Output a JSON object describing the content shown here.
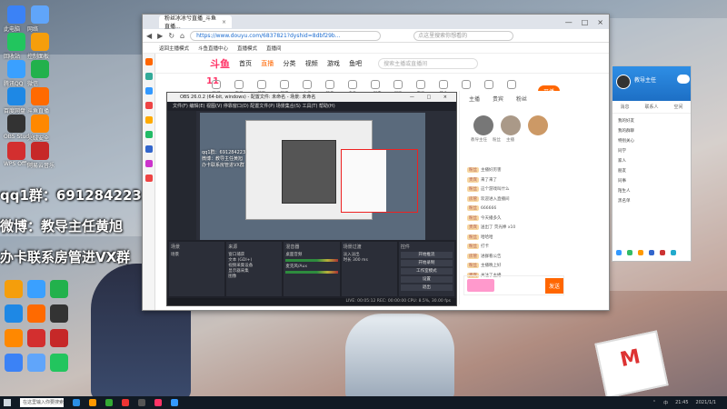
{
  "overlay": {
    "line1": "qq1群：691284223",
    "line2": "微博：教导主任黄旭",
    "line3": "办卡联系房管进VX群"
  },
  "desktop_icons": [
    "此电脑",
    "网络",
    "回收站",
    "控制面板",
    "腾讯QQ",
    "微信",
    "百度网盘",
    "斗鱼直播",
    "OBS Studio",
    "火绒安全",
    "WPS Office",
    "网易云音乐"
  ],
  "browser": {
    "tab_title": "粉丝冰冰兮直播_斗鱼直播...",
    "tab_close": "×",
    "win_controls": [
      "—",
      "□",
      "×"
    ],
    "nav": [
      "◀",
      "▶",
      "↻",
      "⌂"
    ],
    "url": "https://www.douyu.com/6837821?dyshid=8dbf29b...",
    "search_placeholder": "点这里搜索你想看的",
    "bookmarks": [
      "返回主播模式",
      "斗鱼直播中心",
      "直播模式",
      "直播间"
    ],
    "site": {
      "logo": "斗鱼",
      "nav": [
        "首页",
        "直播",
        "分类",
        "视频",
        "游戏",
        "鱼吧"
      ],
      "search_placeholder": "搜索主播或直播间",
      "date": "11",
      "open_button": "开播"
    },
    "categories": [
      "热门",
      "王者",
      "英雄",
      "和平",
      "主机",
      "颜值",
      "户外",
      "一起看",
      "娱乐",
      "音乐",
      "美食",
      "科技",
      "二次元",
      "舞蹈"
    ]
  },
  "obs": {
    "title": "OBS 26.0.2 (64-bit, windows) - 配置文件: 未命名 - 场景: 未命名",
    "win_controls": "— □ ×",
    "menu": "文件(F)  编辑(E)  视图(V)  停靠窗口(D)  配置文件(P)  场景集合(S)  工具(T)  帮助(H)",
    "preview_text": "qq1群：691284223\n微博：教导主任黄旭\n办卡联系房管进VX群",
    "docks": {
      "scenes": {
        "title": "场景",
        "items": [
          "场景"
        ]
      },
      "sources": {
        "title": "来源",
        "items": [
          "窗口捕获",
          "文本 (GDI+)",
          "视频采集设备",
          "显示器采集",
          "图像"
        ]
      },
      "mixer": {
        "title": "混音器",
        "items": [
          "桌面音频",
          "麦克风/Aux"
        ]
      },
      "transitions": {
        "title": "场景过渡",
        "items": [
          "淡入淡出",
          "时长 300 ms"
        ]
      },
      "controls": {
        "title": "控件",
        "items": [
          "开始推流",
          "开始录制",
          "工作室模式",
          "设置",
          "退出"
        ]
      }
    },
    "status": "LIVE: 00:05:12   REC: 00:00:00   CPU: 8.5%, 30.00 fps"
  },
  "chat": {
    "tabs": [
      "主播",
      "贵宾",
      "粉丝"
    ],
    "anchor_names": [
      "教导主任",
      "粉丝",
      "主播"
    ],
    "messages": [
      {
        "badge": "粉丝",
        "text": "主播好厉害"
      },
      {
        "badge": "贵宾",
        "text": "来了来了"
      },
      {
        "badge": "粉丝",
        "text": "这个游戏叫什么"
      },
      {
        "badge": "房管",
        "text": "欢迎进入直播间"
      },
      {
        "badge": "粉丝",
        "text": "666666"
      },
      {
        "badge": "粉丝",
        "text": "今天播多久"
      },
      {
        "badge": "贵宾",
        "text": "送出了 荧光棒 x10"
      },
      {
        "badge": "粉丝",
        "text": "哈哈哈"
      },
      {
        "badge": "粉丝",
        "text": "打卡"
      },
      {
        "badge": "房管",
        "text": "进群看公告"
      },
      {
        "badge": "粉丝",
        "text": "主播晚上好"
      },
      {
        "badge": "贵宾",
        "text": "关注了主播"
      },
      {
        "badge": "粉丝",
        "text": "冲冲冲"
      }
    ],
    "send_label": "发送"
  },
  "widget": {
    "user": "教导主任",
    "tabs": [
      "消息",
      "联系人",
      "空间"
    ],
    "items": [
      "我的好友",
      "我的群聊",
      "特别关心",
      "同学",
      "家人",
      "朋友",
      "同事",
      "陌生人",
      "黑名单"
    ]
  },
  "taskbar": {
    "search": "在这里输入你要搜索的内容",
    "tray": [
      "⌃",
      "中",
      "21:45",
      "2021/1/1"
    ]
  },
  "poster_logo": "M"
}
